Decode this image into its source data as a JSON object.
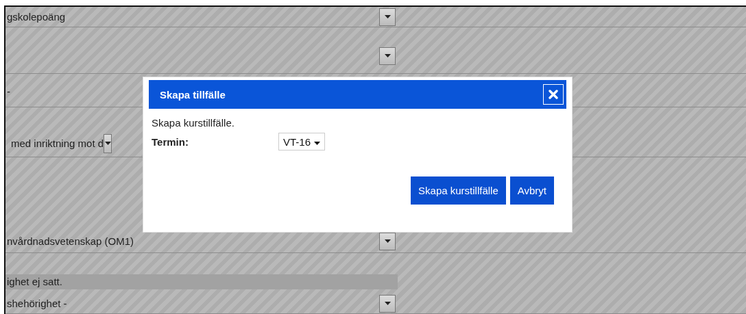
{
  "form_rows": [
    {
      "kind": "select",
      "text": "gskolepoäng"
    },
    {
      "kind": "select"
    },
    {
      "kind": "text",
      "text": "-"
    },
    {
      "kind": "inline-select",
      "text": "med inriktning mot d"
    },
    {
      "kind": "select",
      "text": "nvårdnadsvetenskap (OM1)"
    },
    {
      "kind": "notice",
      "text": "ighet ej satt."
    },
    {
      "kind": "select",
      "text": "shehörighet -"
    }
  ],
  "dialog": {
    "title": "Skapa tillfälle",
    "message": "Skapa kurstillfälle.",
    "field_label": "Termin:",
    "field_value": "VT-16",
    "buttons": [
      "Skapa kurstillfälle",
      "Avbryt"
    ]
  }
}
